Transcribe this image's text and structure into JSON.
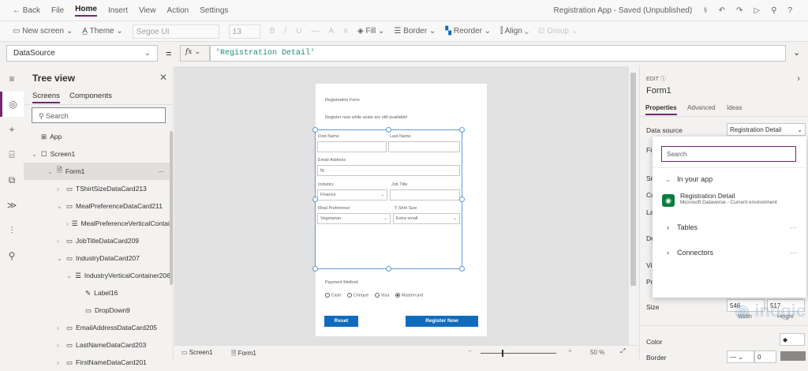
{
  "menu": {
    "back": "Back",
    "items": [
      "File",
      "Home",
      "Insert",
      "View",
      "Action",
      "Settings"
    ],
    "title": "Registration App - Saved (Unpublished)"
  },
  "toolbar": {
    "new_screen": "New screen",
    "theme": "Theme",
    "font": "Segoe UI",
    "size": "13",
    "bold": "B",
    "italic": "/",
    "underline": "U",
    "fill": "Fill",
    "border": "Border",
    "reorder": "Reorder",
    "align": "Align",
    "group": "Group"
  },
  "formula": {
    "property": "DataSource",
    "equals": "=",
    "fx": "fx",
    "value": "'Registration Detail'"
  },
  "tree": {
    "title": "Tree view",
    "tabs": [
      "Screens",
      "Components"
    ],
    "search_placeholder": "Search",
    "items": [
      {
        "label": "App",
        "indent": 0
      },
      {
        "label": "Screen1",
        "indent": 0
      },
      {
        "label": "Form1",
        "indent": 1
      },
      {
        "label": "TShirtSizeDataCard213",
        "indent": 2
      },
      {
        "label": "MealPreferenceDataCard211",
        "indent": 2
      },
      {
        "label": "MealPreferenceVerticalContainer",
        "indent": 3
      },
      {
        "label": "JobTitleDataCard209",
        "indent": 2
      },
      {
        "label": "IndustryDataCard207",
        "indent": 2
      },
      {
        "label": "IndustryVerticalContainer206",
        "indent": 3
      },
      {
        "label": "Label16",
        "indent": 4
      },
      {
        "label": "DropDown9",
        "indent": 4
      },
      {
        "label": "EmailAddressDataCard205",
        "indent": 2
      },
      {
        "label": "LastNameDataCard203",
        "indent": 2
      },
      {
        "label": "FirstNameDataCard201",
        "indent": 2
      }
    ]
  },
  "form": {
    "title": "Registration Form",
    "subtitle": "Register now while seats are still available!",
    "first_name": "First Name",
    "last_name": "Last Name",
    "email": "Email Address",
    "email_value": "tg",
    "industry": "Industry",
    "industry_value": "Finance",
    "job_title": "Job Title",
    "meal": "Meal Preference",
    "meal_value": "Vegetarian",
    "tshirt": "T-Shirt Size",
    "tshirt_value": "Extra small",
    "payment": "Payment Method",
    "payment_options": [
      "Cash",
      "Cheque",
      "Visa",
      "Mastercard"
    ],
    "payment_selected": "Mastercard",
    "reset": "Reset",
    "register": "Register Now"
  },
  "status": {
    "screen": "Screen1",
    "form": "Form1",
    "zoom": "50",
    "zoom_unit": "%",
    "minus": "−",
    "plus": "+"
  },
  "panel": {
    "edit": "EDIT",
    "name": "Form1",
    "tabs": [
      "Properties",
      "Advanced",
      "Ideas"
    ],
    "data_source_label": "Data source",
    "data_source_value": "Registration Detail",
    "hidden_labels": [
      "Fi",
      "Sn",
      "Co",
      "La",
      "De",
      "Vi",
      "Po"
    ],
    "size_label": "Size",
    "width": "546",
    "height": "517",
    "width_label": "Width",
    "height_label": "Height",
    "color_label": "Color",
    "border_label": "Border",
    "border_value": "0"
  },
  "popup": {
    "search_placeholder": "Search",
    "in_your_app": "In your app",
    "source_name": "Registration Detail",
    "source_sub": "Microsoft Dataverse - Current environment",
    "tables": "Tables",
    "connectors": "Connectors",
    "more": "···"
  },
  "watermark": "innovative logic inogic"
}
